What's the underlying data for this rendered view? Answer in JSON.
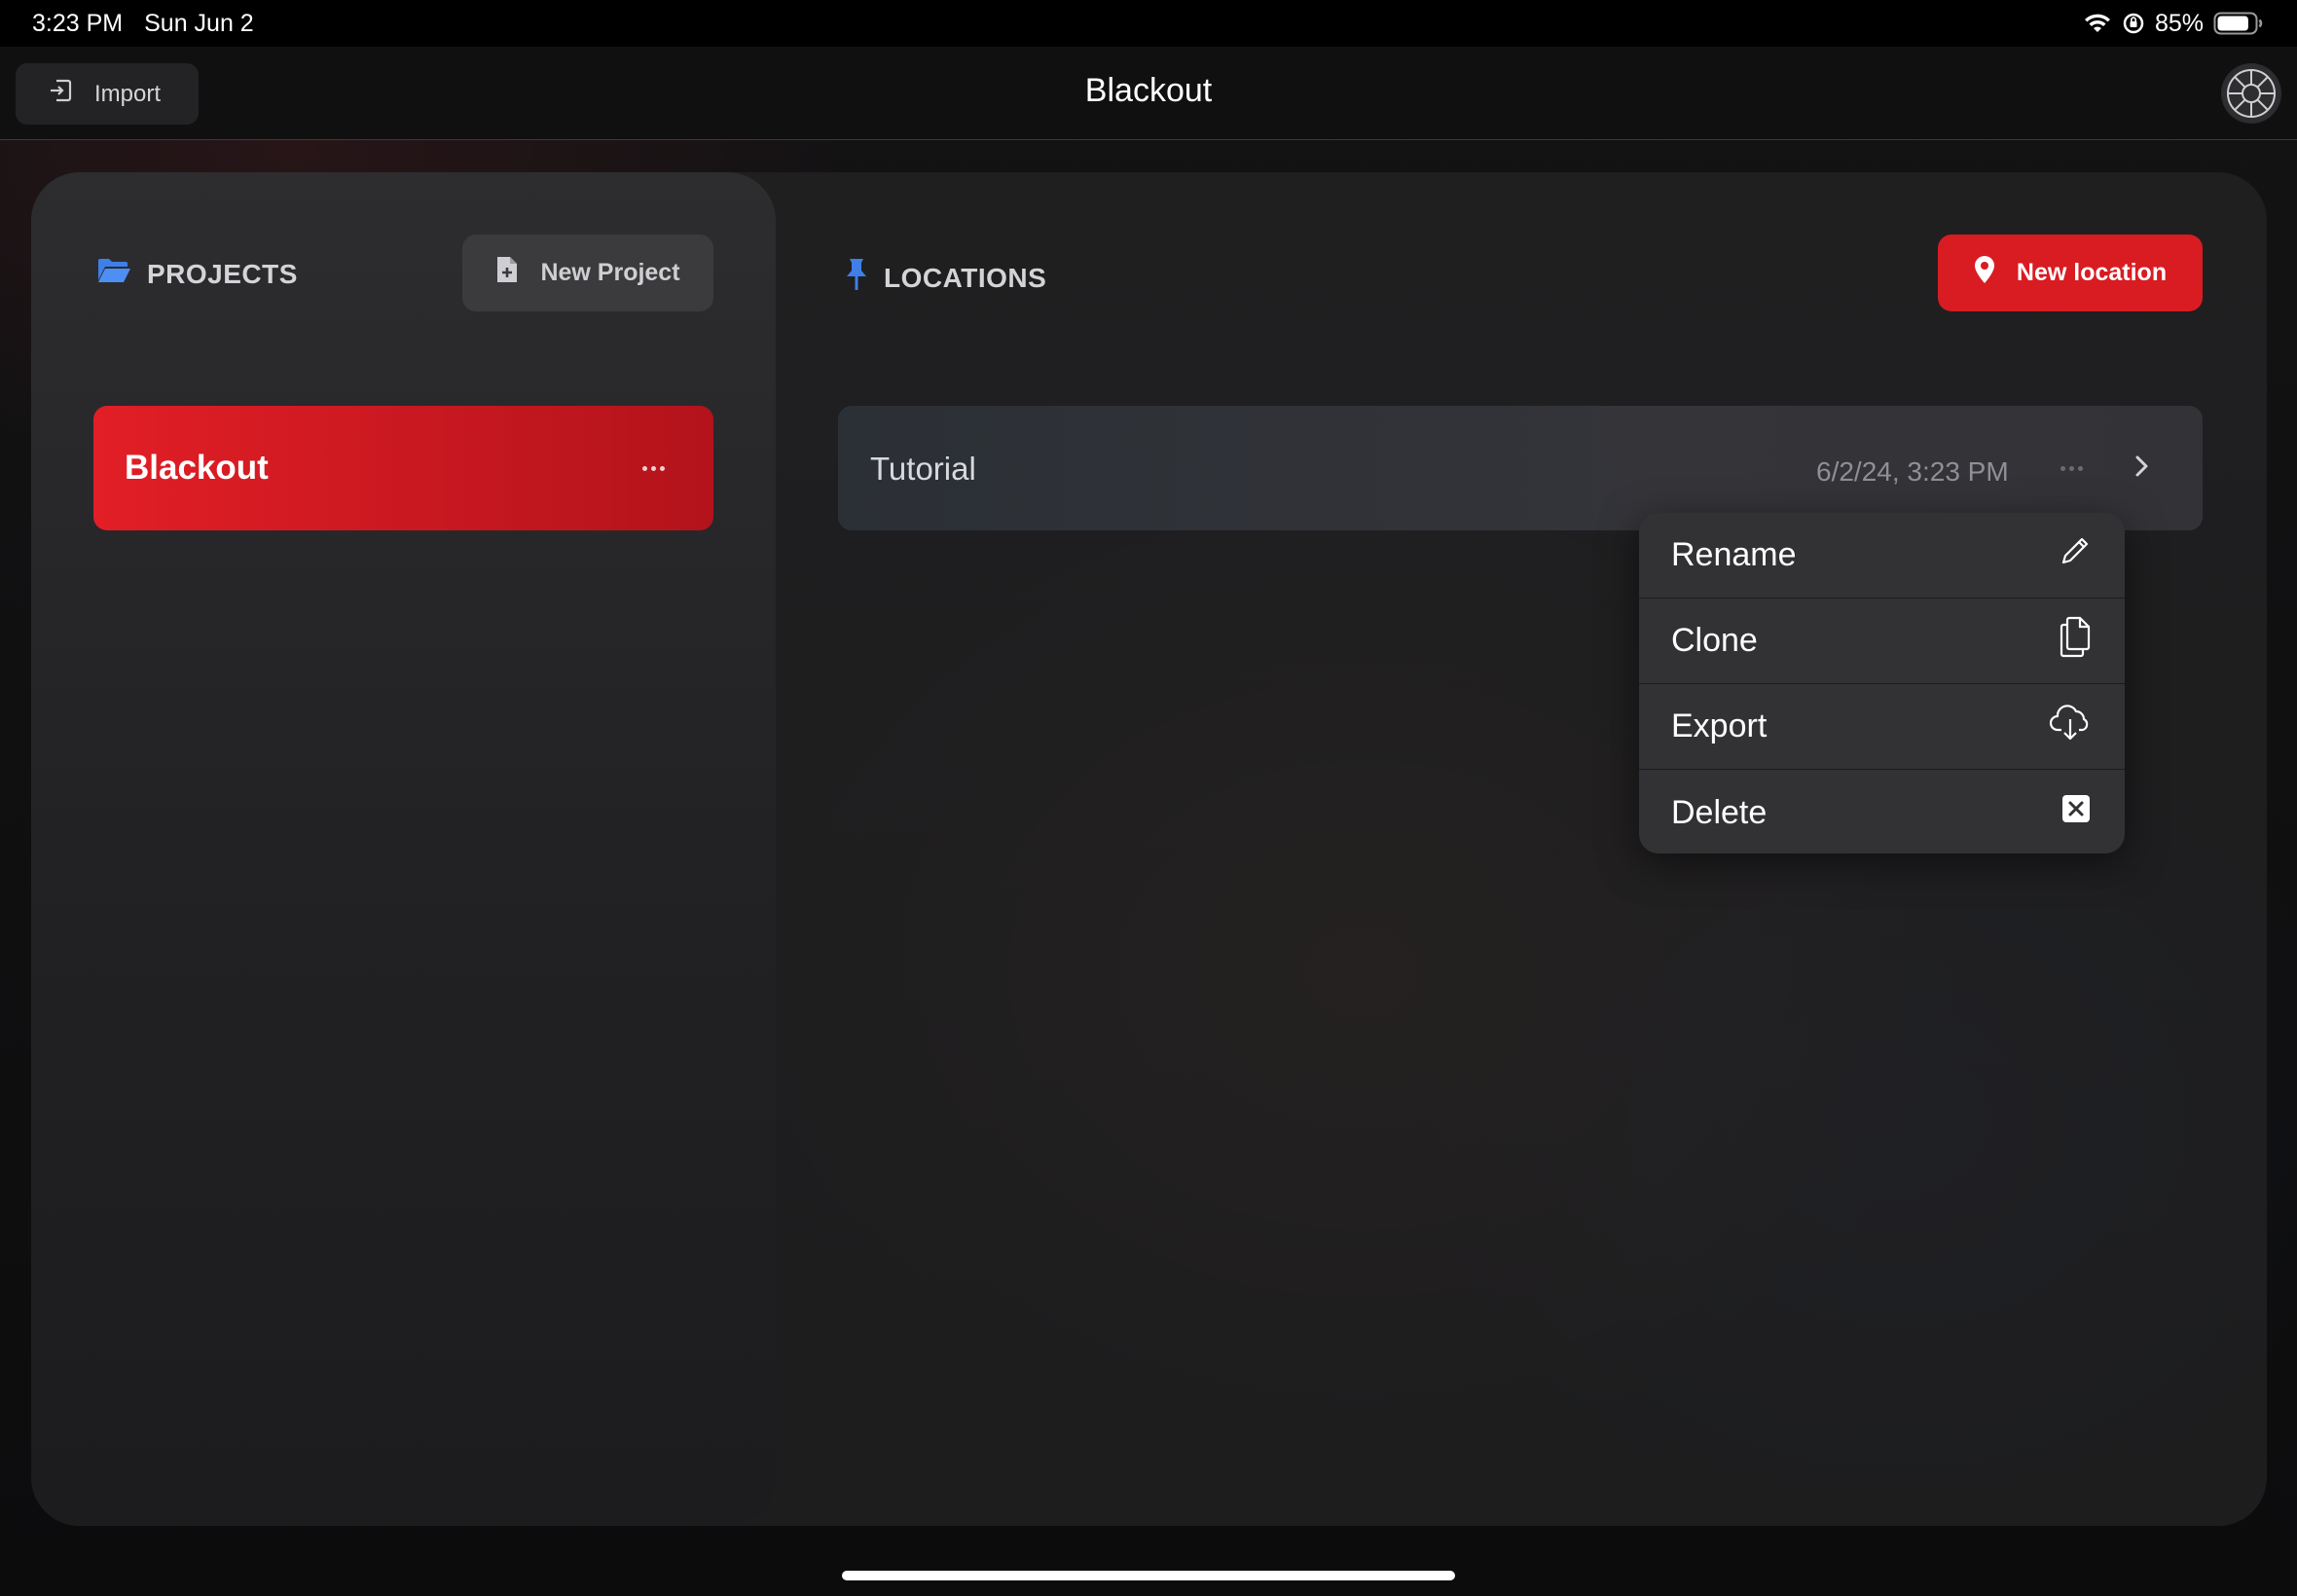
{
  "status_bar": {
    "time": "3:23 PM",
    "date": "Sun Jun 2",
    "battery_percent": "85%",
    "battery_level": 0.85
  },
  "top_bar": {
    "import_label": "Import",
    "title": "Blackout",
    "avatar_icon": "settings-wheel-icon"
  },
  "projects": {
    "heading": "PROJECTS",
    "heading_icon": "folder-open-icon",
    "new_button_label": "New Project",
    "items": [
      {
        "name": "Blackout",
        "selected": true
      }
    ]
  },
  "locations": {
    "heading": "LOCATIONS",
    "heading_icon": "pushpin-icon",
    "new_button_label": "New location",
    "items": [
      {
        "name": "Tutorial",
        "date": "6/2/24, 3:23 PM"
      }
    ]
  },
  "context_menu": {
    "items": [
      {
        "label": "Rename",
        "icon": "pencil-icon"
      },
      {
        "label": "Clone",
        "icon": "copy-icon"
      },
      {
        "label": "Export",
        "icon": "cloud-download-icon"
      },
      {
        "label": "Delete",
        "icon": "delete-box-icon"
      }
    ]
  },
  "colors": {
    "accent_red": "#d81c22",
    "accent_blue": "#3a7bf0"
  }
}
